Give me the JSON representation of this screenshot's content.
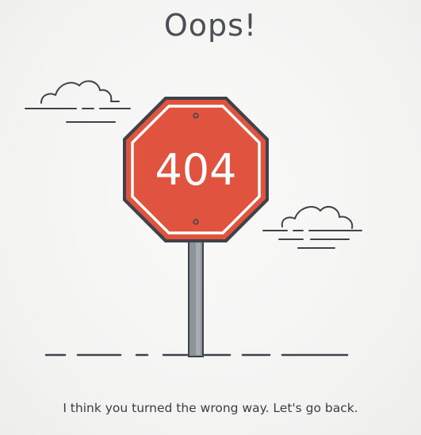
{
  "page": {
    "title": "Oops!",
    "sign_text": "404",
    "message": "I think you turned the wrong way. Let's go back."
  },
  "colors": {
    "background": "#f5f5f4",
    "sign_red": "#e0533e",
    "sign_outline": "#3f4349",
    "pole": "#8d9399",
    "text": "#4b4f55"
  },
  "icons": {
    "sign": "stop-sign-icon",
    "cloud_left": "cloud-icon",
    "cloud_right": "cloud-icon"
  }
}
